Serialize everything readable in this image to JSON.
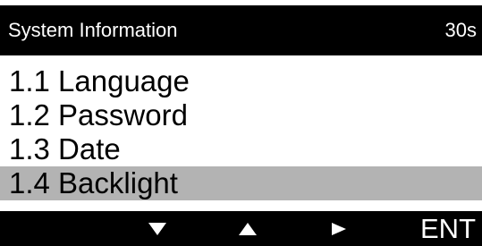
{
  "header": {
    "title": "System Information",
    "timer": "30s"
  },
  "menu": {
    "items": [
      {
        "label": "1.1 Language",
        "selected": false
      },
      {
        "label": "1.2 Password",
        "selected": false
      },
      {
        "label": "1.3 Date",
        "selected": false
      },
      {
        "label": "1.4 Backlight",
        "selected": true
      }
    ]
  },
  "footer": {
    "keys": [
      {
        "icon": "down-arrow-icon"
      },
      {
        "icon": "up-arrow-icon"
      },
      {
        "icon": "right-arrow-icon"
      },
      {
        "label": "ENT"
      }
    ]
  },
  "colors": {
    "header_bg": "#000000",
    "footer_bg": "#000000",
    "selected_bg": "#b3b3b3",
    "text": "#000000",
    "inverse_text": "#ffffff"
  }
}
